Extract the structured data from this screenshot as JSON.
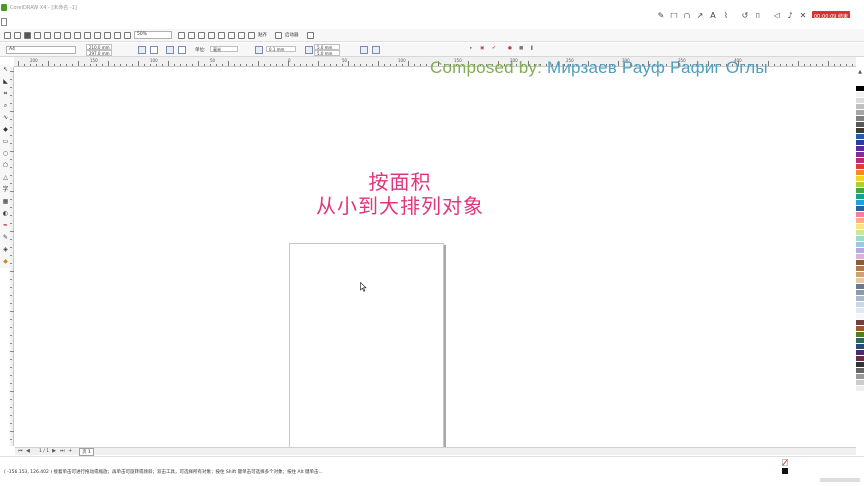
{
  "window": {
    "title": "CorelDRAW X4 - [未命名 -1]"
  },
  "recorder": {
    "tools": [
      "pen-icon",
      "rect-icon",
      "circle-icon",
      "arrow-icon",
      "text-A-icon",
      "brush-icon",
      "undo-icon",
      "trash-icon",
      "camera-icon",
      "mic-icon",
      "close-icon"
    ],
    "timer_label": "00:00:09 结束"
  },
  "toolbar": {
    "zoom_value": "50%",
    "snap_label": "贴齐",
    "launch_label": "启动器"
  },
  "property_bar": {
    "page_size": "A4",
    "width": "210.0 mm",
    "height": "297.0 mm",
    "units_label": "单位:",
    "units_value": "毫米",
    "nudge": "0.1 mm",
    "dup_x": "5.0 mm",
    "dup_y": "5.0 mm"
  },
  "ruler": {
    "h_numbers": [
      "200",
      "150",
      "100",
      "50",
      "0",
      "50",
      "100",
      "150",
      "200",
      "250",
      "300",
      "350",
      "400"
    ]
  },
  "headline": {
    "line1": "按面积",
    "line2": "从小到大排列对象"
  },
  "watermark": {
    "prefix": "Composed by:",
    "name": "Мирзаев Рауф Рафиг Оглы"
  },
  "palette": {
    "colors": [
      "#ffffff",
      "#000000",
      "#f2f2f2",
      "#dcdcdc",
      "#bfbfbf",
      "#a6a6a6",
      "#808080",
      "#595959",
      "#3b3b3b",
      "#1a5fb4",
      "#2a3f95",
      "#5a2a95",
      "#8a2a95",
      "#c0267c",
      "#e23a3a",
      "#f08a24",
      "#f5d31e",
      "#a8d32a",
      "#3aa845",
      "#1e9e8a",
      "#23a0d5",
      "#2c5fa8",
      "#ff7aa0",
      "#ffb07a",
      "#ffe08a",
      "#c8e89a",
      "#9adcc8",
      "#9ac8ec",
      "#b8a8e0",
      "#e0b0d8",
      "#8a5a3a",
      "#b07a4a",
      "#d0a070",
      "#e8c8a0",
      "#6a7a8a",
      "#8a9aaa",
      "#aabaca",
      "#cad8e4",
      "#e0e8f0",
      "#f4f8fc",
      "#7a3a3a",
      "#9a5a2a",
      "#5a7a2a",
      "#2a6a5a",
      "#2a4a7a",
      "#4a2a6a",
      "#6a2a4a",
      "#333333",
      "#666666",
      "#999999",
      "#cccccc",
      "#eeeeee",
      "#ffffff"
    ]
  },
  "pagebar": {
    "page_counter": "1 / 1",
    "page_tab": "页 1"
  },
  "status": {
    "text": "( -156.153, 126.402 )   接着单击可进行拖动或缩放；再单击可旋转或倾斜；双击工具，可选择所有对象；按住 Shift 键单击可选择多个对象；按住 Alt 键单击..."
  }
}
